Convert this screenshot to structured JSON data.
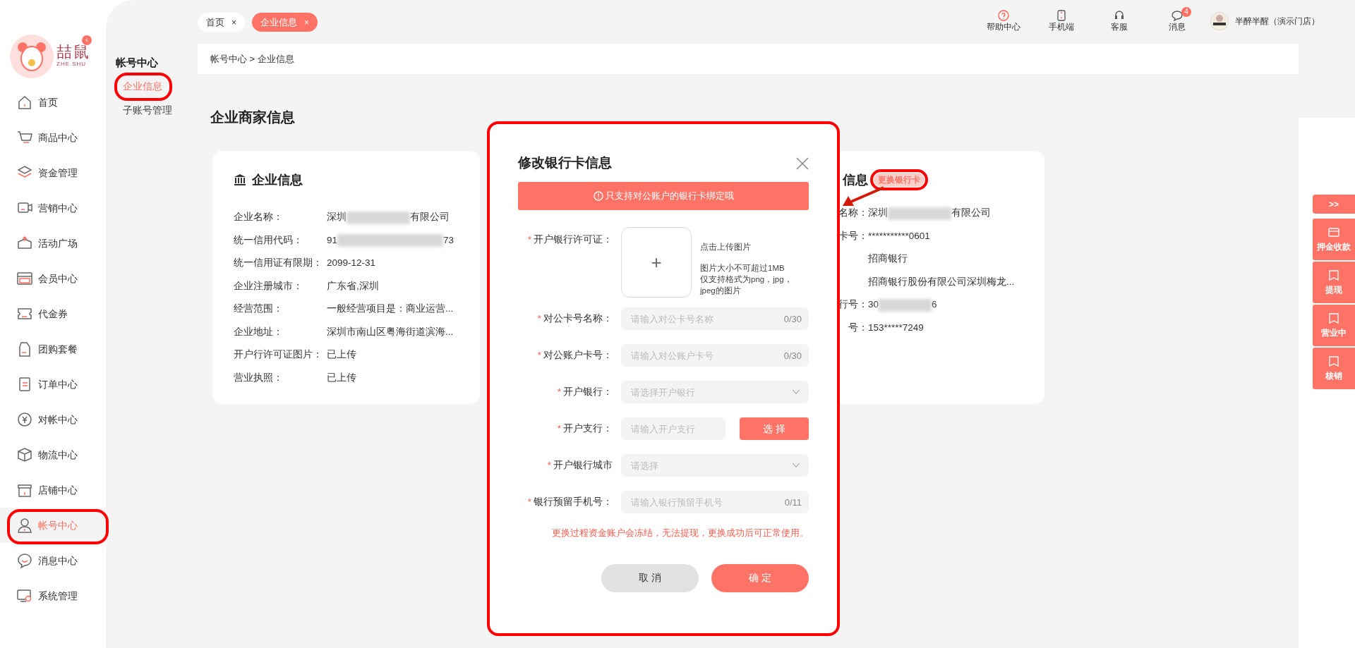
{
  "sidebar": {
    "logo_text": "喆鼠",
    "logo_subtext": "ZHE SHU",
    "collapse_glyph": "‹",
    "items": [
      {
        "label": "首页",
        "selected": false,
        "highlighted": false
      },
      {
        "label": "商品中心",
        "selected": false,
        "highlighted": false
      },
      {
        "label": "资金管理",
        "selected": false,
        "highlighted": false
      },
      {
        "label": "营销中心",
        "selected": false,
        "highlighted": false
      },
      {
        "label": "活动广场",
        "selected": false,
        "highlighted": false
      },
      {
        "label": "会员中心",
        "selected": false,
        "highlighted": false
      },
      {
        "label": "代金券",
        "selected": false,
        "highlighted": false
      },
      {
        "label": "团购套餐",
        "selected": false,
        "highlighted": false
      },
      {
        "label": "订单中心",
        "selected": false,
        "highlighted": false
      },
      {
        "label": "对帐中心",
        "selected": false,
        "highlighted": false
      },
      {
        "label": "物流中心",
        "selected": false,
        "highlighted": false
      },
      {
        "label": "店铺中心",
        "selected": false,
        "highlighted": false
      },
      {
        "label": "帐号中心",
        "selected": true,
        "highlighted": true
      },
      {
        "label": "消息中心",
        "selected": false,
        "highlighted": false
      },
      {
        "label": "系统管理",
        "selected": false,
        "highlighted": false
      }
    ]
  },
  "subnav": {
    "title": "帐号中心",
    "items": [
      {
        "label": "企业信息",
        "selected": true,
        "highlighted": true
      },
      {
        "label": "子账号管理",
        "selected": false,
        "highlighted": false
      }
    ]
  },
  "tabs": [
    {
      "label": "首页",
      "selected": false,
      "close": "×"
    },
    {
      "label": "企业信息",
      "selected": true,
      "close": "×"
    }
  ],
  "header_actions": [
    {
      "label": "帮助中心"
    },
    {
      "label": "手机端"
    },
    {
      "label": "客服"
    },
    {
      "label": "消息",
      "badge": "4"
    }
  ],
  "user": {
    "name": "半醉半醒（演示门店）"
  },
  "breadcrumb": "帐号中心 > 企业信息",
  "page_title": "企业商家信息",
  "company_card": {
    "title": "企业信息",
    "rows": [
      {
        "label": "企业名称：",
        "value": "深圳",
        "redacted": true,
        "value_end": "有限公司"
      },
      {
        "label": "统一信用代码：",
        "value": "91",
        "redacted": true,
        "value_end": "73"
      },
      {
        "label": "统一信用证有限期：",
        "value": "2099-12-31",
        "redacted": false
      },
      {
        "label": "企业注册城市：",
        "value": "广东省,深圳",
        "redacted": false
      },
      {
        "label": "经营范围：",
        "value": "一般经营项目是：商业运营...",
        "redacted": false
      },
      {
        "label": "企业地址：",
        "value": "深圳市南山区粤海街道滨海...",
        "redacted": false
      },
      {
        "label": "开户行许可证图片：",
        "value": "已上传",
        "redacted": false
      },
      {
        "label": "营业执照：",
        "value": "已上传",
        "redacted": false
      }
    ]
  },
  "bank_card": {
    "title": "信息",
    "action": {
      "label": "更换银行卡",
      "highlighted": true
    },
    "rows": [
      {
        "label": "名称：",
        "value": "深圳",
        "redacted": true,
        "value_end": "有限公司"
      },
      {
        "label": "卡号：",
        "value": "***********0601",
        "redacted": false
      },
      {
        "value": "招商银行",
        "redacted": false
      },
      {
        "value": "招商银行股份有限公司深圳梅龙...",
        "redacted": false
      },
      {
        "label": "行号：",
        "value": "30",
        "redacted": true,
        "value_end": "6"
      },
      {
        "label": "号：",
        "value": "153*****7249",
        "redacted": false
      }
    ]
  },
  "annotation_arrow": true,
  "side_actions": [
    {
      "label": ">>",
      "kind": "toggle"
    },
    {
      "label": "押金收款",
      "kind": "action"
    },
    {
      "label": "提现",
      "kind": "action"
    },
    {
      "label": "营业中",
      "kind": "action"
    },
    {
      "label": "核销",
      "kind": "action"
    }
  ],
  "dialog": {
    "title": "修改银行卡信息",
    "highlighted": true,
    "notice": "只支持对公账户的银行卡绑定哦",
    "fields": [
      {
        "kind": "upload",
        "label": "开户银行许可证：",
        "required": "*",
        "glyph": "+",
        "hints": [
          "点击上传图片",
          "图片大小不可超过1MB",
          "仅支持格式为png，jpg，jpeg的图片"
        ]
      },
      {
        "kind": "text",
        "label": "对公卡号名称：",
        "required": "*",
        "placeholder": "请输入对公卡号名称",
        "counter": "0/30"
      },
      {
        "kind": "text",
        "label": "对公账户卡号：",
        "required": "*",
        "placeholder": "请输入对公账户卡号",
        "counter": "0/30"
      },
      {
        "kind": "select",
        "label": "开户银行：",
        "required": "*",
        "placeholder": "请选择开户银行"
      },
      {
        "kind": "pick",
        "label": "开户支行：",
        "required": "*",
        "placeholder": "请输入开户支行",
        "button": "选 择"
      },
      {
        "kind": "select",
        "label": "开户银行城市",
        "required": "*",
        "placeholder": "请选择"
      },
      {
        "kind": "text",
        "label": "银行预留手机号：",
        "required": "*",
        "placeholder": "请输入银行预留手机号",
        "counter": "0/11"
      }
    ],
    "warning": "更换过程资金账户会冻结，无法提现，更换成功后可正常使用。",
    "cancel": "取 消",
    "confirm": "确 定"
  }
}
